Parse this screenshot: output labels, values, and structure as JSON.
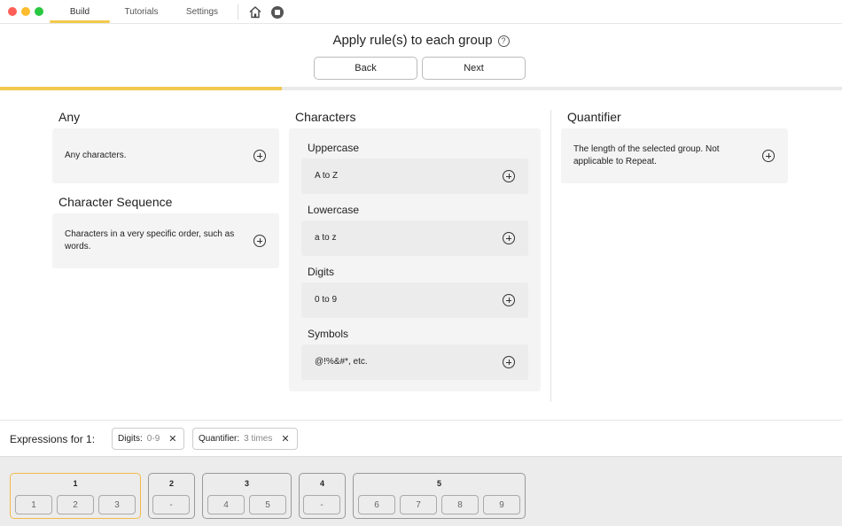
{
  "tabs": {
    "build": "Build",
    "tutorials": "Tutorials",
    "settings": "Settings"
  },
  "icons": {
    "home": "home-icon",
    "stop": "stop-icon",
    "help": "help-icon",
    "add": "plus-circle-icon",
    "remove": "close-icon"
  },
  "header": {
    "title": "Apply rule(s) to each group",
    "help_glyph": "?",
    "back_label": "Back",
    "next_label": "Next",
    "progress": 0.335
  },
  "accent_color": "#f2c94c",
  "any": {
    "heading": "Any",
    "description": "Any characters."
  },
  "sequence": {
    "heading": "Character Sequence",
    "description": "Characters in a very specific order, such as words."
  },
  "characters": {
    "heading": "Characters",
    "uppercase": {
      "label": "Uppercase",
      "value": "A to Z"
    },
    "lowercase": {
      "label": "Lowercase",
      "value": "a to z"
    },
    "digits": {
      "label": "Digits",
      "value": "0 to 9"
    },
    "symbols": {
      "label": "Symbols",
      "value": "@!%&#*, etc."
    }
  },
  "quantifier": {
    "heading": "Quantifier",
    "description": "The length of the selected group.  Not applicable to Repeat."
  },
  "expressions": {
    "label": "Expressions for 1:",
    "chips": [
      {
        "name": "Digits:",
        "value": "0-9"
      },
      {
        "name": "Quantifier:",
        "value": "3 times"
      }
    ]
  },
  "groups": [
    {
      "label": "1",
      "slots": [
        "1",
        "2",
        "3"
      ]
    },
    {
      "label": "2",
      "slots": [
        "-"
      ]
    },
    {
      "label": "3",
      "slots": [
        "4",
        "5"
      ]
    },
    {
      "label": "4",
      "slots": [
        "-"
      ]
    },
    {
      "label": "5",
      "slots": [
        "6",
        "7",
        "8",
        "9"
      ]
    }
  ]
}
